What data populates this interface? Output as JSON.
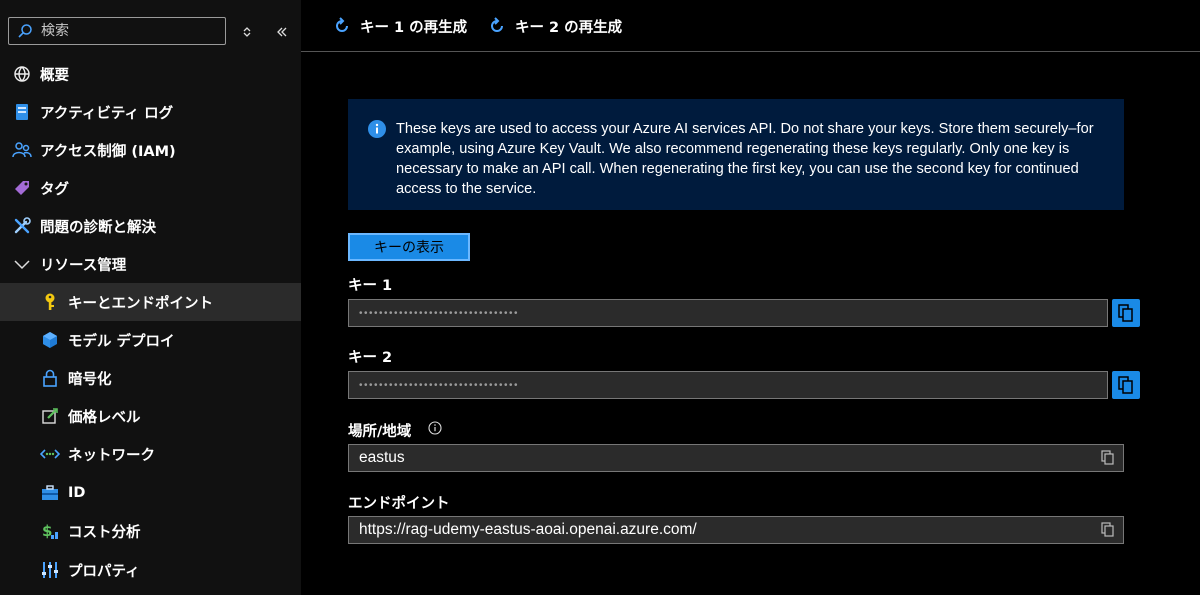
{
  "sidebar": {
    "search_placeholder": "検索",
    "items": [
      {
        "label": "概要",
        "icon": "overview-icon"
      },
      {
        "label": "アクティビティ ログ",
        "icon": "activity-log-icon"
      },
      {
        "label": "アクセス制御 (IAM)",
        "icon": "iam-icon"
      },
      {
        "label": "タグ",
        "icon": "tag-icon"
      },
      {
        "label": "問題の診断と解決",
        "icon": "diagnose-icon"
      },
      {
        "label": "リソース管理",
        "icon": "chevron-down-icon",
        "expanded": true
      },
      {
        "label": "キーとエンドポイント",
        "icon": "key-icon",
        "active": true
      },
      {
        "label": "モデル デプロイ",
        "icon": "cube-icon"
      },
      {
        "label": "暗号化",
        "icon": "lock-icon"
      },
      {
        "label": "価格レベル",
        "icon": "edit-icon"
      },
      {
        "label": "ネットワーク",
        "icon": "network-icon"
      },
      {
        "label": "ID",
        "icon": "identity-icon"
      },
      {
        "label": "コスト分析",
        "icon": "cost-icon"
      },
      {
        "label": "プロパティ",
        "icon": "properties-icon"
      }
    ]
  },
  "toolbar": {
    "regen_key1": "キー 1 の再生成",
    "regen_key2": "キー 2 の再生成"
  },
  "info": {
    "text": "These keys are used to access your Azure AI services API. Do not share your keys. Store them securely–for example, using Azure Key Vault. We also recommend regenerating these keys regularly. Only one key is necessary to make an API call. When regenerating the first key, you can use the second key for continued access to the service."
  },
  "main": {
    "show_keys_label": "キーの表示",
    "key1_label": "キー 1",
    "key1_value": "••••••••••••••••••••••••••••••••",
    "key2_label": "キー 2",
    "key2_value": "••••••••••••••••••••••••••••••••",
    "location_label": "場所/地域",
    "location_value": "eastus",
    "endpoint_label": "エンドポイント",
    "endpoint_value": "https://rag-udemy-eastus-aoai.openai.azure.com/"
  },
  "colors": {
    "accent": "#1a8ae6",
    "info_bg": "#001b3d",
    "sidebar_bg": "#111111",
    "active_bg": "#2b2b2b"
  }
}
